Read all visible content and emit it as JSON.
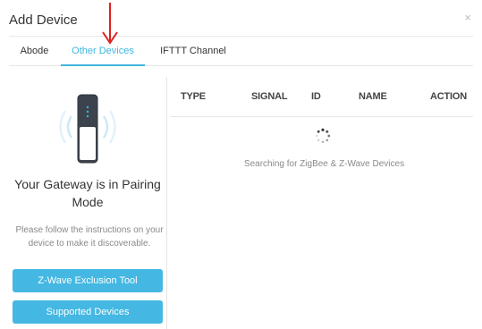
{
  "modal": {
    "title": "Add Device",
    "close_glyph": "×"
  },
  "tabs": [
    {
      "label": "Abode",
      "active": false
    },
    {
      "label": "Other Devices",
      "active": true
    },
    {
      "label": "IFTTT Channel",
      "active": false
    }
  ],
  "left_panel": {
    "pairing_title": "Your Gateway is in Pairing Mode",
    "instructions": "Please follow the instructions on your device to make it discoverable.",
    "zwave_button": "Z-Wave Exclusion Tool",
    "supported_button": "Supported Devices"
  },
  "table": {
    "headers": [
      "TYPE",
      "SIGNAL",
      "ID",
      "NAME",
      "ACTION"
    ],
    "status": "Searching for ZigBee & Z-Wave Devices"
  },
  "colors": {
    "accent": "#40b6de",
    "button": "#44b8e2",
    "annotation_arrow": "#e02020"
  },
  "icons": {
    "gateway": "gateway-device-icon",
    "spinner": "loading-spinner-icon",
    "arrow": "annotation-arrow-icon"
  }
}
